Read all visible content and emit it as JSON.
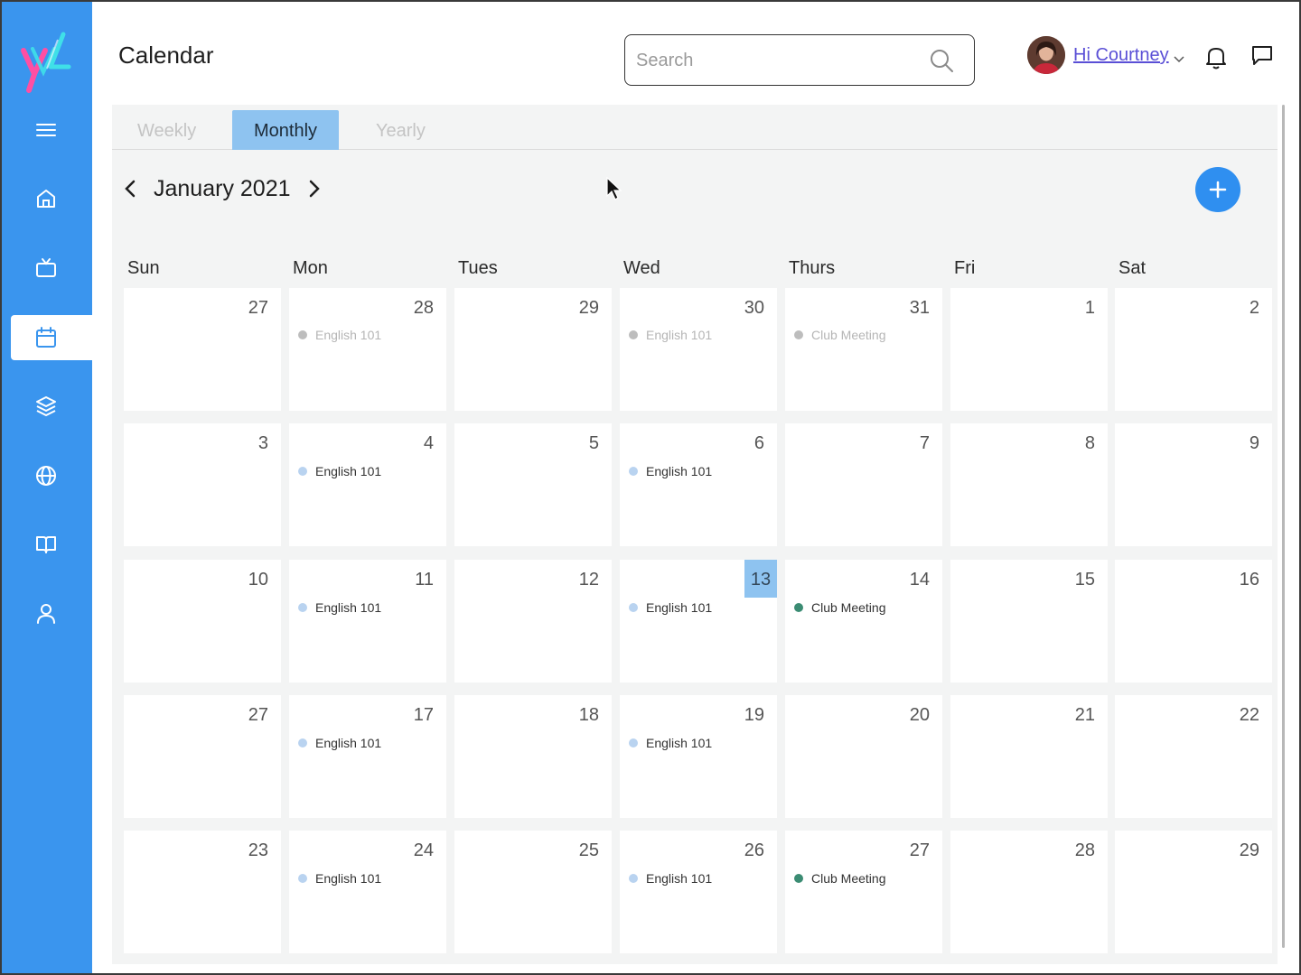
{
  "header": {
    "title": "Calendar",
    "search_placeholder": "Search",
    "greeting": "Hi Courtney"
  },
  "sidebar": {
    "items": [
      {
        "icon": "menu-icon"
      },
      {
        "icon": "home-icon"
      },
      {
        "icon": "tv-icon"
      },
      {
        "icon": "calendar-icon",
        "active": true
      },
      {
        "icon": "layers-icon"
      },
      {
        "icon": "globe-icon"
      },
      {
        "icon": "book-icon"
      },
      {
        "icon": "user-icon"
      }
    ]
  },
  "tabs": [
    "Weekly",
    "Monthly",
    "Yearly"
  ],
  "active_tab": "Monthly",
  "month_label": "January 2021",
  "weekdays": [
    "Sun",
    "Mon",
    "Tues",
    "Wed",
    "Thurs",
    "Fri",
    "Sat"
  ],
  "colors": {
    "sidebar": "#3a95ee",
    "accent": "#2f8ff0",
    "highlight": "#8ec3f0",
    "english_dot": "#b9d3f0",
    "club_dot": "#3b8c73",
    "greeting": "#5a4fd6"
  },
  "weeks": [
    [
      {
        "day": "27"
      },
      {
        "day": "28",
        "event": "English 101",
        "type": "faded"
      },
      {
        "day": "29"
      },
      {
        "day": "30",
        "event": "English 101",
        "type": "faded"
      },
      {
        "day": "31",
        "event": "Club Meeting",
        "type": "faded"
      },
      {
        "day": "1"
      },
      {
        "day": "2"
      }
    ],
    [
      {
        "day": "3"
      },
      {
        "day": "4",
        "event": "English 101",
        "type": "english"
      },
      {
        "day": "5"
      },
      {
        "day": "6",
        "event": "English 101",
        "type": "english"
      },
      {
        "day": "7"
      },
      {
        "day": "8"
      },
      {
        "day": "9"
      }
    ],
    [
      {
        "day": "10"
      },
      {
        "day": "11",
        "event": "English 101",
        "type": "english"
      },
      {
        "day": "12"
      },
      {
        "day": "13",
        "event": "English 101",
        "type": "english",
        "today": true
      },
      {
        "day": "14",
        "event": "Club Meeting",
        "type": "club"
      },
      {
        "day": "15"
      },
      {
        "day": "16"
      }
    ],
    [
      {
        "day": "27"
      },
      {
        "day": "17",
        "event": "English 101",
        "type": "english"
      },
      {
        "day": "18"
      },
      {
        "day": "19",
        "event": "English 101",
        "type": "english"
      },
      {
        "day": "20"
      },
      {
        "day": "21"
      },
      {
        "day": "22"
      }
    ],
    [
      {
        "day": "23"
      },
      {
        "day": "24",
        "event": "English 101",
        "type": "english"
      },
      {
        "day": "25"
      },
      {
        "day": "26",
        "event": "English 101",
        "type": "english"
      },
      {
        "day": "27",
        "event": "Club Meeting",
        "type": "club"
      },
      {
        "day": "28"
      },
      {
        "day": "29"
      }
    ]
  ]
}
